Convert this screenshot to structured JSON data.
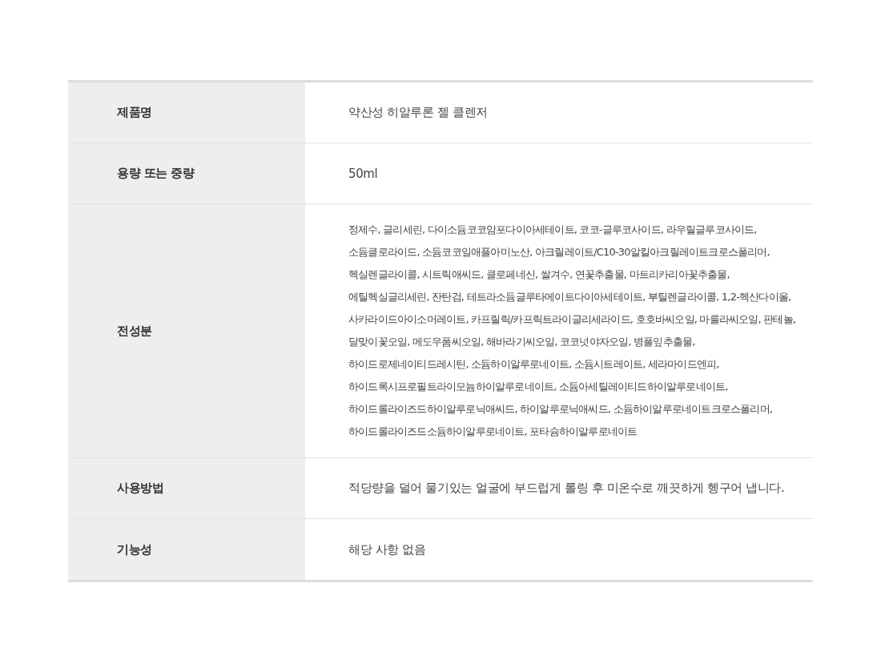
{
  "table": {
    "rows": [
      {
        "label": "제품명",
        "value": "약산성 히알루론 젤 클렌저"
      },
      {
        "label": "용량 또는 중량",
        "value": "50ml"
      },
      {
        "label": "전성분",
        "value": "정제수, 글리세린, 다이소듐코코암포다이아세테이트, 코코-글루코사이드, 라우릴글루코사이드, 소듐클로라이드, 소듐코코일애플아미노산, 아크릴레이트/C10-30알킬아크릴레이트크로스폴리머, 헥실렌글라이콜, 시트릭애씨드, 클로페네신, 쌀겨수, 연꽃추출물, 마트리카리아꽃추출물, 에틸헥실글리세린, 잔탄검, 테트라소듐글루타메이트다이아세테이트, 부틸렌글라이콜, 1,2-헥산다이올, 사카라이드아이소머레이트, 카프릴릭/카프릭트라이글리세라이드, 호호바씨오일, 마룰라씨오일, 판테놀, 달맞이꽃오일, 메도우폼씨오일, 해바라기씨오일, 코코넛야자오일, 병풀잎추출물, 하이드로제네이티드레시틴, 소듐하이알루로네이트, 소듐시트레이트, 세라마이드엔피, 하이드록시프로필트라이모늄하이알루로네이트, 소듐아세틸레이티드하이알루로네이트, 하이드롤라이즈드하이알루로닉애씨드, 하이알루로닉애씨드, 소듐하이알루로네이트크로스폴리머, 하이드롤라이즈드소듐하이알루로네이트, 포타슘하이알루로네이트"
      },
      {
        "label": "사용방법",
        "value": "적당량을 덜어 물기있는 얼굴에 부드럽게 롤링 후 미온수로 깨끗하게 헹구어 냅니다."
      },
      {
        "label": "기능성",
        "value": "해당 사항 없음"
      }
    ]
  }
}
